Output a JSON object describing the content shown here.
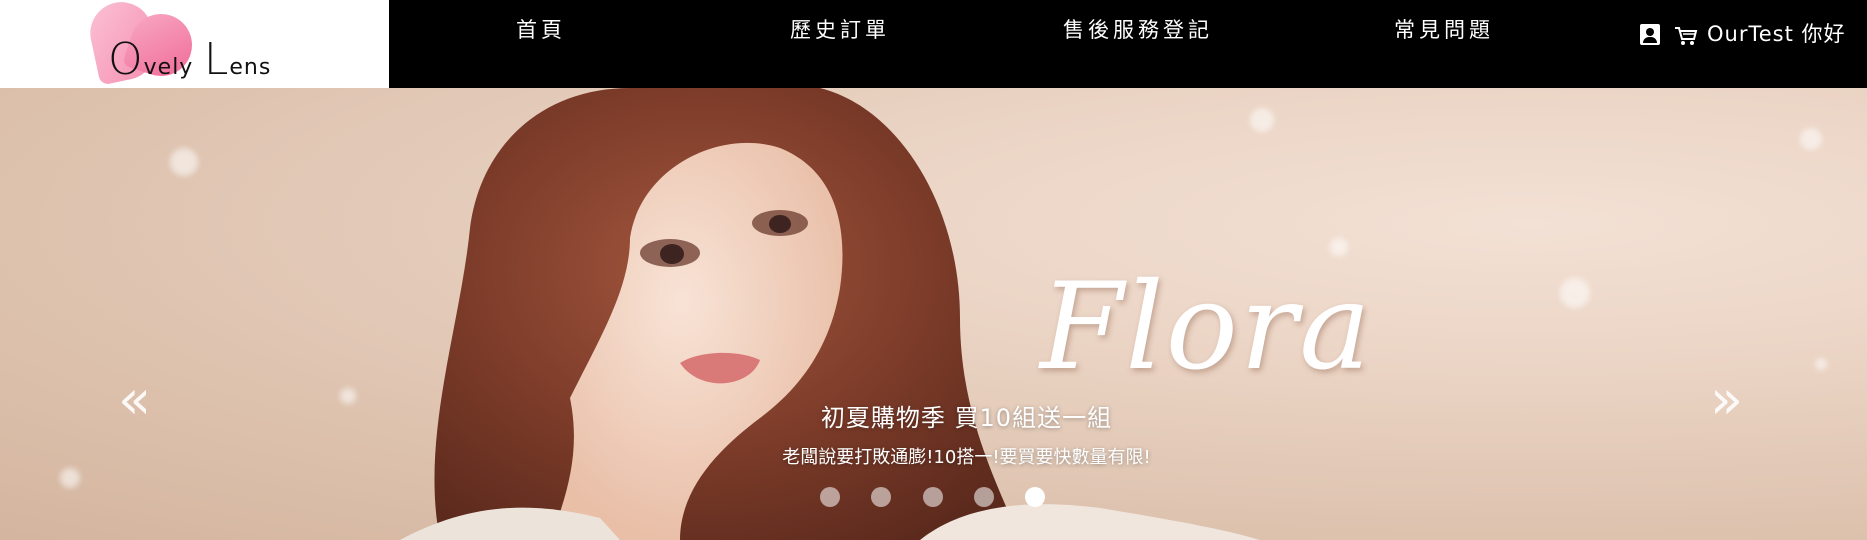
{
  "header": {
    "logo": {
      "text_first": "O",
      "text_second": "vely",
      "text_third": "L",
      "text_fourth": "ens"
    },
    "nav": [
      {
        "label": "首頁"
      },
      {
        "label": "歷史訂單"
      },
      {
        "label": "售後服務登記"
      },
      {
        "label": "常見問題"
      }
    ],
    "user_greeting": "OurTest 你好",
    "icons": {
      "user": "user-icon",
      "cart": "cart-icon"
    }
  },
  "hero": {
    "brand_script": "Flora",
    "caption_title": "初夏購物季 買10組送一組",
    "caption_subtitle": "老闆說要打敗通膨!10搭一!要買要快數量有限!",
    "prev_glyph": "«",
    "next_glyph": "»",
    "slides_total": 5,
    "active_slide": 5
  },
  "colors": {
    "topbar": "#000000",
    "logo_pink": "#f58fb1",
    "hero_bg": "#ead3c3"
  }
}
